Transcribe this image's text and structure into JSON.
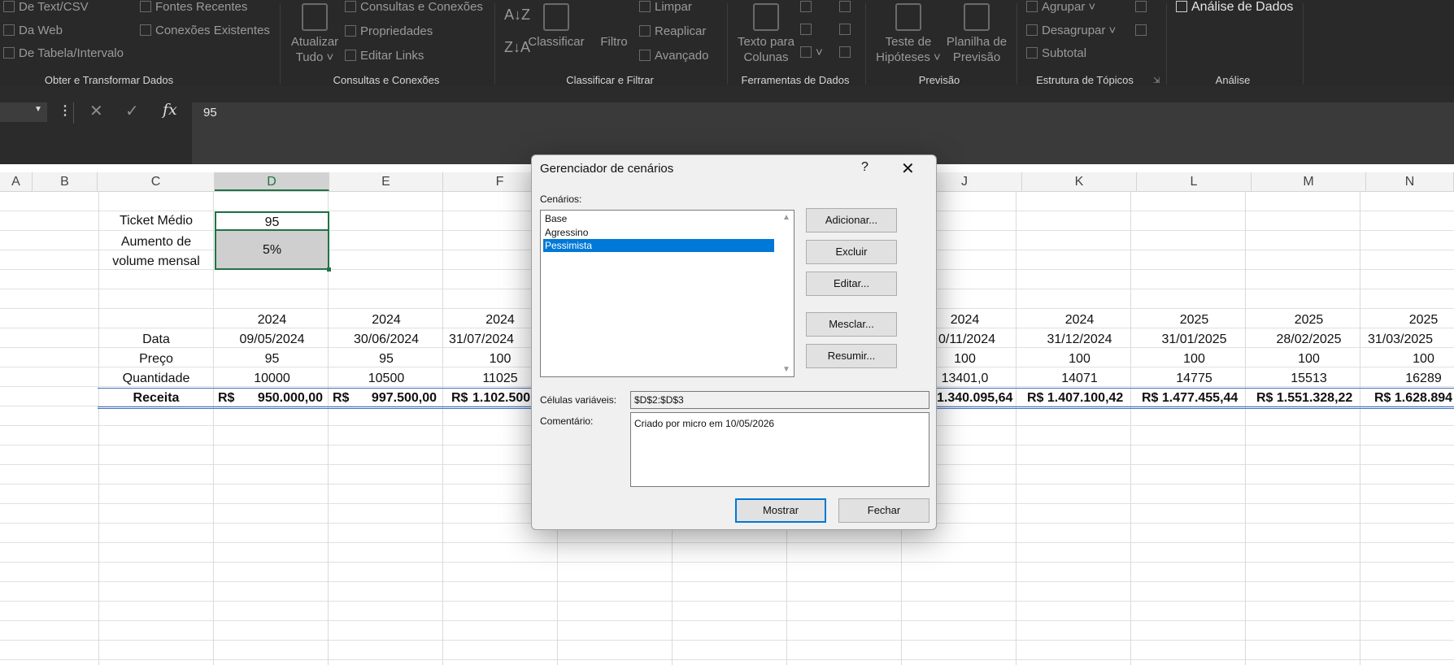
{
  "ribbon": {
    "groups": [
      {
        "label": "Obter e Transformar Dados"
      },
      {
        "label": "Consultas e Conexões"
      },
      {
        "label": "Classificar e Filtrar"
      },
      {
        "label": "Ferramentas de Dados"
      },
      {
        "label": "Previsão"
      },
      {
        "label": "Estrutura de Tópicos"
      },
      {
        "label": "Análise"
      }
    ],
    "get_data": {
      "text_csv": "De Text/CSV",
      "web": "Da Web",
      "table_range": "De Tabela/Intervalo",
      "recent_sources": "Fontes Recentes",
      "existing_connections": "Conexões Existentes"
    },
    "queries": {
      "refresh_all_line1": "Atualizar",
      "refresh_all_line2": "Tudo",
      "queries_connections": "Consultas e Conexões",
      "properties": "Propriedades",
      "edit_links": "Editar Links"
    },
    "sort_filter": {
      "sort_az": "A↓Z",
      "sort_za": "Z↓A",
      "sort": "Classificar",
      "filter": "Filtro",
      "clear": "Limpar",
      "reapply": "Reaplicar",
      "advanced": "Avançado"
    },
    "data_tools": {
      "text_to_columns_line1": "Texto para",
      "text_to_columns_line2": "Colunas"
    },
    "forecast": {
      "what_if_line1": "Teste de",
      "what_if_line2": "Hipóteses",
      "forecast_sheet_line1": "Planilha de",
      "forecast_sheet_line2": "Previsão"
    },
    "outline": {
      "group": "Agrupar",
      "ungroup": "Desagrupar",
      "subtotal": "Subtotal"
    },
    "analysis": {
      "data_analysis": "Análise de Dados"
    }
  },
  "formula_bar": {
    "value": "95",
    "fx": "fx"
  },
  "columns": [
    "A",
    "B",
    "C",
    "D",
    "E",
    "F",
    "J",
    "K",
    "L",
    "M",
    "N"
  ],
  "sheet": {
    "ticket_label": "Ticket Médio",
    "ticket_value": "95",
    "volume_label_line1": "Aumento de",
    "volume_label_line2": "volume mensal",
    "volume_value": "5%",
    "row_labels": {
      "data": "Data",
      "preco": "Preço",
      "quantidade": "Quantidade",
      "receita": "Receita"
    },
    "left_cols": [
      {
        "year": "2024",
        "date": "09/05/2024",
        "price": "95",
        "qty": "10000",
        "revenue_cur": "R$",
        "revenue": "950.000,00"
      },
      {
        "year": "2024",
        "date": "30/06/2024",
        "price": "95",
        "qty": "10500",
        "revenue_cur": "R$",
        "revenue": "997.500,00"
      },
      {
        "year": "2024",
        "date": "31/07/2024",
        "price": "100",
        "qty": "11025",
        "revenue_cur": "R$",
        "revenue": "1.102.500,"
      }
    ],
    "right_cols": [
      {
        "year": "2024",
        "date": "0/11/2024",
        "price": "100",
        "qty": "13401,0",
        "revenue": "1.340.095,64"
      },
      {
        "year": "2024",
        "date": "31/12/2024",
        "price": "100",
        "qty": "14071",
        "revenue": "R$ 1.407.100,42"
      },
      {
        "year": "2025",
        "date": "31/01/2025",
        "price": "100",
        "qty": "14775",
        "revenue": "R$ 1.477.455,44"
      },
      {
        "year": "2025",
        "date": "28/02/2025",
        "price": "100",
        "qty": "15513",
        "revenue": "R$ 1.551.328,22"
      },
      {
        "year": "2025",
        "date": "31/03/2025",
        "price": "100",
        "qty": "16289",
        "revenue": "R$ 1.628.894"
      }
    ]
  },
  "dialog": {
    "title": "Gerenciador de cenários",
    "help": "?",
    "close": "✕",
    "scenarios_label": "Cenários:",
    "scenarios": [
      "Base",
      "Agressino",
      "Pessimista"
    ],
    "buttons": {
      "add": "Adicionar...",
      "delete": "Excluir",
      "edit": "Editar...",
      "merge": "Mesclar...",
      "summary": "Resumir...",
      "show": "Mostrar",
      "close": "Fechar"
    },
    "changing_cells_label": "Células variáveis:",
    "changing_cells": "$D$2:$D$3",
    "comment_label": "Comentário:",
    "comment": "Criado por micro em 10/05/2026"
  }
}
